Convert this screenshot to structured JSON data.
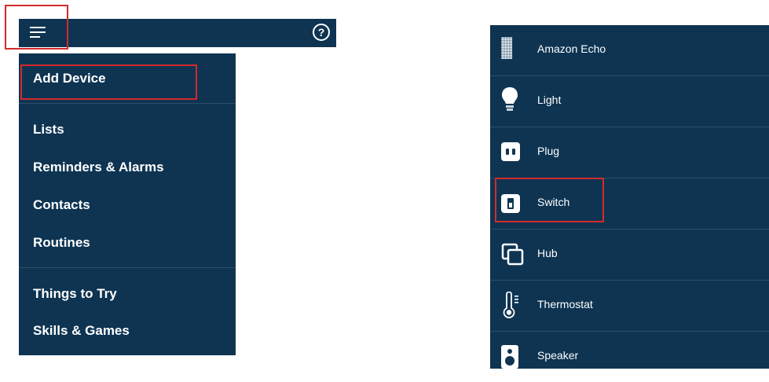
{
  "header": {
    "menu_icon": "hamburger-menu-icon",
    "help_icon": "help-circle-icon",
    "help_glyph": "?"
  },
  "side_menu": {
    "items": [
      {
        "label": "Add Device"
      },
      {
        "label": "Lists"
      },
      {
        "label": "Reminders & Alarms"
      },
      {
        "label": "Contacts"
      },
      {
        "label": "Routines"
      },
      {
        "label": "Things to Try"
      },
      {
        "label": "Skills & Games"
      }
    ]
  },
  "device_list": {
    "items": [
      {
        "label": "Amazon Echo",
        "icon": "echo-device-icon"
      },
      {
        "label": "Light",
        "icon": "lightbulb-icon"
      },
      {
        "label": "Plug",
        "icon": "plug-icon"
      },
      {
        "label": "Switch",
        "icon": "switch-icon"
      },
      {
        "label": "Hub",
        "icon": "hub-icon"
      },
      {
        "label": "Thermostat",
        "icon": "thermometer-icon"
      },
      {
        "label": "Speaker",
        "icon": "speaker-icon"
      }
    ]
  },
  "colors": {
    "panel_background": "#0e3452",
    "highlight_border": "#d42a2a",
    "text": "#ffffff",
    "divider": "#2c4d68"
  }
}
